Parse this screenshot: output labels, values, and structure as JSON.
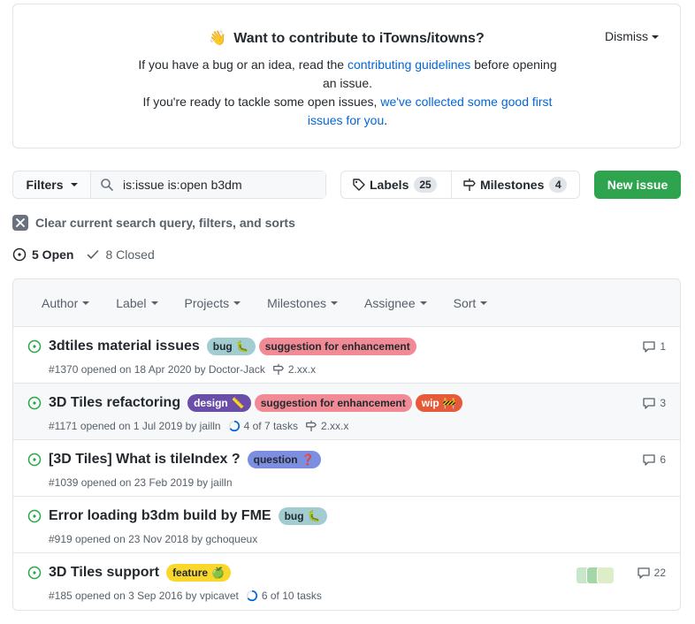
{
  "banner": {
    "title": "Want to contribute to iTowns/itowns?",
    "line1_pre": "If you have a bug or an idea, read the ",
    "line1_link": "contributing guidelines",
    "line1_post": " before opening an issue.",
    "line2_pre": "If you're ready to tackle some open issues, ",
    "line2_link": "we've collected some good first issues for you",
    "line2_post": ".",
    "dismiss": "Dismiss"
  },
  "toolbar": {
    "filters_label": "Filters",
    "search_value": "is:issue is:open b3dm",
    "labels_label": "Labels",
    "labels_count": "25",
    "milestones_label": "Milestones",
    "milestones_count": "4",
    "new_issue_label": "New issue"
  },
  "clear_query": "Clear current search query, filters, and sorts",
  "states": {
    "open": "5 Open",
    "closed": "8 Closed"
  },
  "list_header": {
    "author": "Author",
    "label": "Label",
    "projects": "Projects",
    "milestones": "Milestones",
    "assignee": "Assignee",
    "sort": "Sort"
  },
  "issues": [
    {
      "title": "3dtiles material issues",
      "labels": [
        {
          "text": "bug",
          "emoji": "🐛",
          "bg": "#a2cdd0",
          "fg": "#24292e"
        },
        {
          "text": "suggestion for enhancement",
          "emoji": "",
          "bg": "#f08b95",
          "fg": "#24292e"
        }
      ],
      "meta": "#1370 opened on 18 Apr 2020 by Doctor-Jack",
      "milestone": "2.xx.x",
      "tasks": "",
      "comments": "1"
    },
    {
      "title": "3D Tiles refactoring",
      "labels": [
        {
          "text": "design",
          "emoji": "📏",
          "bg": "#6b4ea8",
          "fg": "#ffffff"
        },
        {
          "text": "suggestion for enhancement",
          "emoji": "",
          "bg": "#f08b95",
          "fg": "#24292e"
        },
        {
          "text": "wip",
          "emoji": "🚧",
          "bg": "#e65a3a",
          "fg": "#ffffff"
        }
      ],
      "meta": "#1171 opened on 1 Jul 2019 by jailln",
      "tasks": "4 of 7 tasks",
      "milestone": "2.xx.x",
      "comments": "3"
    },
    {
      "title": "[3D Tiles] What is tileIndex ?",
      "labels": [
        {
          "text": "question",
          "emoji": "❓",
          "bg": "#7b8ee0",
          "fg": "#24292e"
        }
      ],
      "meta": "#1039 opened on 23 Feb 2019 by jailln",
      "tasks": "",
      "milestone": "",
      "comments": "6"
    },
    {
      "title": "Error loading b3dm build by FME",
      "labels": [
        {
          "text": "bug",
          "emoji": "🐛",
          "bg": "#a2cdd0",
          "fg": "#24292e"
        }
      ],
      "meta": "#919 opened on 23 Nov 2018 by gchoqueux",
      "tasks": "",
      "milestone": "",
      "comments": ""
    },
    {
      "title": "3D Tiles support",
      "labels": [
        {
          "text": "feature",
          "emoji": "🍏",
          "bg": "#f9d72c",
          "fg": "#24292e"
        }
      ],
      "meta": "#185 opened on 3 Sep 2016 by vpicavet",
      "tasks": "6 of 10 tasks",
      "milestone": "",
      "comments": "22"
    }
  ],
  "colors": {
    "open_green": "#28a745",
    "primary_button": "#2ea44f",
    "link": "#0366d6"
  }
}
